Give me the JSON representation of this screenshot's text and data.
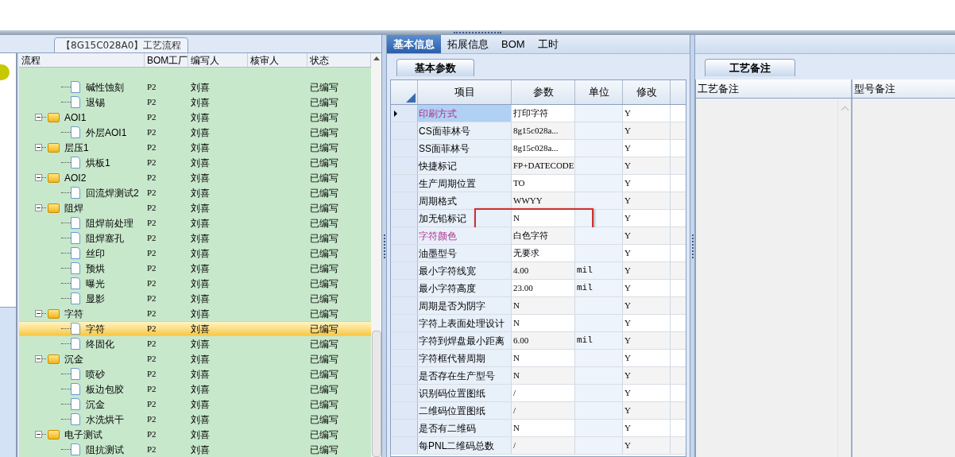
{
  "flow_panel": {
    "title": "【8G15C028A0】工艺流程",
    "columns": [
      "流程",
      "BOM工厂",
      "编写人",
      "核审人",
      "状态"
    ],
    "tree": [
      {
        "children": [
          {
            "label": "碱性蚀刻",
            "bom": "P2",
            "writer": "刘喜",
            "status": "已编写",
            "selected": false
          },
          {
            "label": "退锡",
            "bom": "P2",
            "writer": "刘喜",
            "status": "已编写",
            "selected": false
          }
        ]
      },
      {
        "label": "AOI1",
        "bom": "P2",
        "writer": "刘喜",
        "status": "已编写",
        "selected": false,
        "expanded": true,
        "children": [
          {
            "label": "外层AOI1",
            "bom": "P2",
            "writer": "刘喜",
            "status": "已编写",
            "selected": false
          }
        ]
      },
      {
        "label": "层压1",
        "bom": "P2",
        "writer": "刘喜",
        "status": "已编写",
        "selected": false,
        "expanded": true,
        "children": [
          {
            "label": "烘板1",
            "bom": "P2",
            "writer": "刘喜",
            "status": "已编写",
            "selected": false
          }
        ]
      },
      {
        "label": "AOI2",
        "bom": "P2",
        "writer": "刘喜",
        "status": "已编写",
        "selected": false,
        "expanded": true,
        "children": [
          {
            "label": "回流焊测试2",
            "bom": "P2",
            "writer": "刘喜",
            "status": "已编写",
            "selected": false
          }
        ]
      },
      {
        "label": "阻焊",
        "bom": "P2",
        "writer": "刘喜",
        "status": "已编写",
        "selected": false,
        "expanded": true,
        "children": [
          {
            "label": "阻焊前处理",
            "bom": "P2",
            "writer": "刘喜",
            "status": "已编写",
            "selected": false
          },
          {
            "label": "阻焊塞孔",
            "bom": "P2",
            "writer": "刘喜",
            "status": "已编写",
            "selected": false
          },
          {
            "label": "丝印",
            "bom": "P2",
            "writer": "刘喜",
            "status": "已编写",
            "selected": false
          },
          {
            "label": "预烘",
            "bom": "P2",
            "writer": "刘喜",
            "status": "已编写",
            "selected": false
          },
          {
            "label": "曝光",
            "bom": "P2",
            "writer": "刘喜",
            "status": "已编写",
            "selected": false
          },
          {
            "label": "显影",
            "bom": "P2",
            "writer": "刘喜",
            "status": "已编写",
            "selected": false
          }
        ]
      },
      {
        "label": "字符",
        "bom": "P2",
        "writer": "刘喜",
        "status": "已编写",
        "selected": false,
        "expanded": true,
        "children": [
          {
            "label": "字符",
            "bom": "P2",
            "writer": "刘喜",
            "status": "已编写",
            "selected": true
          },
          {
            "label": "终固化",
            "bom": "P2",
            "writer": "刘喜",
            "status": "已编写",
            "selected": false
          }
        ]
      },
      {
        "label": "沉金",
        "bom": "P2",
        "writer": "刘喜",
        "status": "已编写",
        "selected": false,
        "expanded": true,
        "children": [
          {
            "label": "喷砂",
            "bom": "P2",
            "writer": "刘喜",
            "status": "已编写",
            "selected": false
          },
          {
            "label": "板边包胶",
            "bom": "P2",
            "writer": "刘喜",
            "status": "已编写",
            "selected": false
          },
          {
            "label": "沉金",
            "bom": "P2",
            "writer": "刘喜",
            "status": "已编写",
            "selected": false
          },
          {
            "label": "水洗烘干",
            "bom": "P2",
            "writer": "刘喜",
            "status": "已编写",
            "selected": false
          }
        ]
      },
      {
        "label": "电子测试",
        "bom": "P2",
        "writer": "刘喜",
        "status": "已编写",
        "selected": false,
        "expanded": true,
        "children": [
          {
            "label": "阻抗测试",
            "bom": "P2",
            "writer": "刘喜",
            "status": "已编写",
            "selected": false
          }
        ]
      }
    ]
  },
  "info_panel": {
    "tabs": [
      {
        "label": "基本信息",
        "selected": true
      },
      {
        "label": "拓展信息",
        "selected": false
      },
      {
        "label": "BOM",
        "selected": false
      },
      {
        "label": "工时",
        "selected": false
      }
    ],
    "subtab": "基本参数",
    "columns": [
      "项目",
      "参数",
      "单位",
      "修改"
    ],
    "rows": [
      {
        "item": "印刷方式",
        "value": "打印字符",
        "unit": "",
        "modify": "Y",
        "highlighted": true,
        "selected": true,
        "annotated": false
      },
      {
        "item": "CS面菲林号",
        "value": "8g15c028a...",
        "unit": "",
        "modify": "Y",
        "highlighted": false,
        "selected": false,
        "annotated": false
      },
      {
        "item": "SS面菲林号",
        "value": "8g15c028a...",
        "unit": "",
        "modify": "Y",
        "highlighted": false,
        "selected": false,
        "annotated": false
      },
      {
        "item": "快捷标记",
        "value": "FP+DATECODE",
        "unit": "",
        "modify": "Y",
        "highlighted": false,
        "selected": false,
        "annotated": false
      },
      {
        "item": "生产周期位置",
        "value": "TO",
        "unit": "",
        "modify": "Y",
        "highlighted": false,
        "selected": false,
        "annotated": false
      },
      {
        "item": "周期格式",
        "value": "WWYY",
        "unit": "",
        "modify": "Y",
        "highlighted": false,
        "selected": false,
        "annotated": false
      },
      {
        "item": "加无铅标记",
        "value": "N",
        "unit": "",
        "modify": "Y",
        "highlighted": false,
        "selected": false,
        "annotated": true
      },
      {
        "item": "字符颜色",
        "value": "白色字符",
        "unit": "",
        "modify": "Y",
        "highlighted": true,
        "selected": false,
        "annotated": false
      },
      {
        "item": "油墨型号",
        "value": "无要求",
        "unit": "",
        "modify": "Y",
        "highlighted": false,
        "selected": false,
        "annotated": false
      },
      {
        "item": "最小字符线宽",
        "value": "4.00",
        "unit": "mil",
        "modify": "Y",
        "highlighted": false,
        "selected": false,
        "annotated": false
      },
      {
        "item": "最小字符高度",
        "value": "23.00",
        "unit": "mil",
        "modify": "Y",
        "highlighted": false,
        "selected": false,
        "annotated": false
      },
      {
        "item": "周期是否为阴字",
        "value": "N",
        "unit": "",
        "modify": "Y",
        "highlighted": false,
        "selected": false,
        "annotated": false
      },
      {
        "item": "字符上表面处理设计",
        "value": "N",
        "unit": "",
        "modify": "Y",
        "highlighted": false,
        "selected": false,
        "annotated": false
      },
      {
        "item": "字符到焊盘最小距离",
        "value": "6.00",
        "unit": "mil",
        "modify": "Y",
        "highlighted": false,
        "selected": false,
        "annotated": false
      },
      {
        "item": "字符框代替周期",
        "value": "N",
        "unit": "",
        "modify": "Y",
        "highlighted": false,
        "selected": false,
        "annotated": false
      },
      {
        "item": "是否存在生产型号",
        "value": "N",
        "unit": "",
        "modify": "Y",
        "highlighted": false,
        "selected": false,
        "annotated": false
      },
      {
        "item": "识别码位置图纸",
        "value": "/",
        "unit": "",
        "modify": "Y",
        "highlighted": false,
        "selected": false,
        "annotated": false
      },
      {
        "item": "二维码位置图纸",
        "value": "/",
        "unit": "",
        "modify": "Y",
        "highlighted": false,
        "selected": false,
        "annotated": false
      },
      {
        "item": "是否有二维码",
        "value": "N",
        "unit": "",
        "modify": "Y",
        "highlighted": false,
        "selected": false,
        "annotated": false
      },
      {
        "item": "每PNL二维码总数",
        "value": "/",
        "unit": "",
        "modify": "Y",
        "highlighted": false,
        "selected": false,
        "annotated": false
      }
    ]
  },
  "notes_panel": {
    "subtab": "工艺备注",
    "columns": [
      "工艺备注",
      "型号备注"
    ]
  }
}
